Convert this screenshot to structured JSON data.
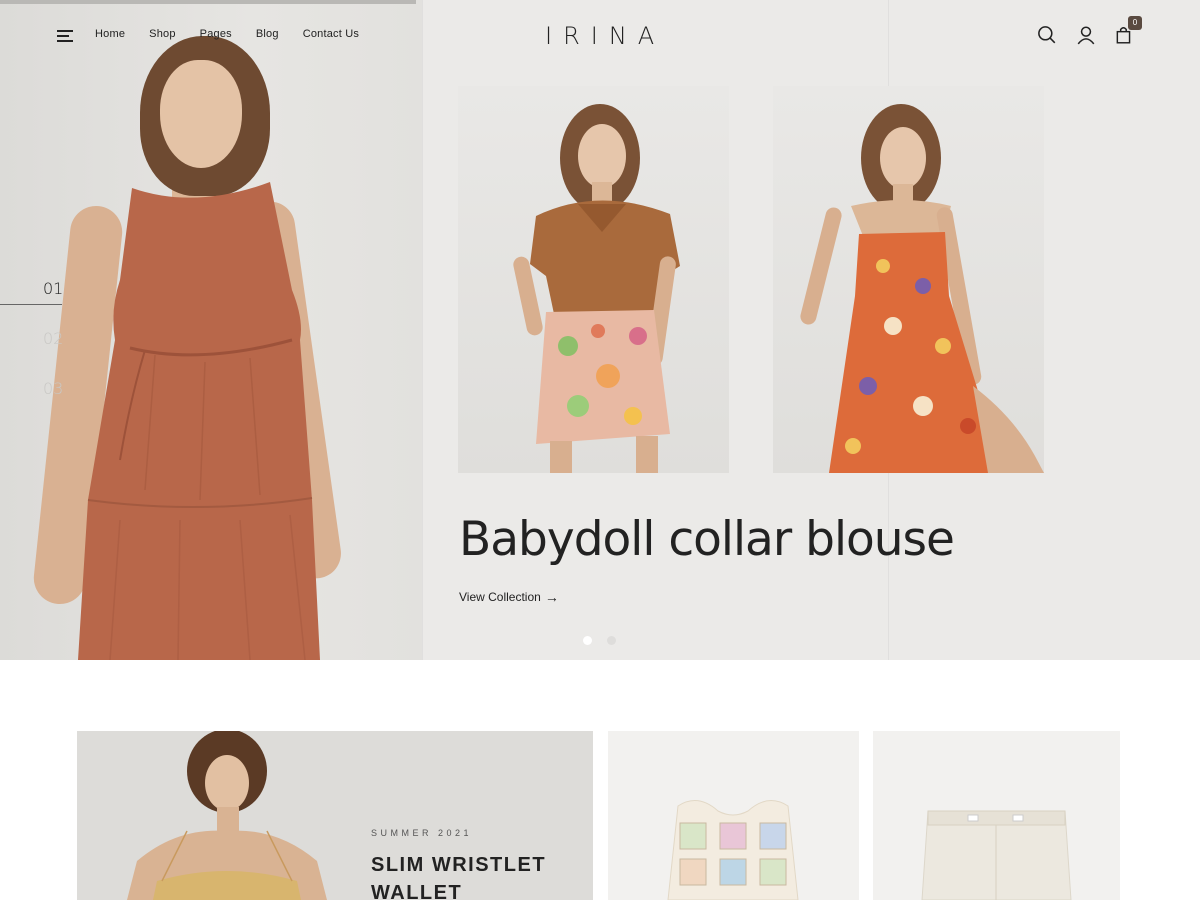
{
  "colors": {
    "accent": "#5a4a40",
    "text": "#222222",
    "hero_bg": "#ebeae8",
    "dress_rust": "#b8674a"
  },
  "header": {
    "menu_icon": "hamburger-menu-icon",
    "nav": [
      "Home",
      "Shop",
      "Pages",
      "Blog",
      "Contact Us"
    ],
    "logo": "IRINA",
    "icons": [
      "search-icon",
      "user-icon",
      "shopping-bag-icon"
    ],
    "cart_count": "0"
  },
  "hero": {
    "slides": [
      "01",
      "02",
      "03"
    ],
    "active_slide": "01",
    "headline": "Babydoll collar blouse",
    "cta": "View Collection",
    "cta_icon": "arrow-right-icon",
    "dots_count": 2,
    "active_dot": 1
  },
  "banner": {
    "eyebrow": "SUMMER 2021",
    "title": "SLIM WRISTLET\nWALLET"
  }
}
